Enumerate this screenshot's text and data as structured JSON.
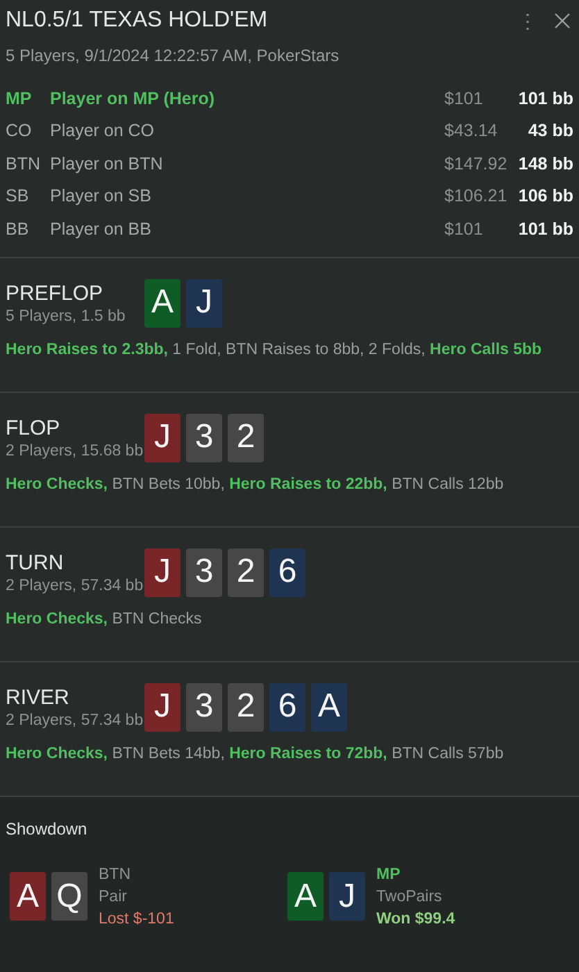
{
  "header": {
    "title": "NL0.5/1 TEXAS HOLD'EM",
    "subtitle": "5 Players, 9/1/2024 12:22:57 AM, PokerStars",
    "menu_glyph": "⋮"
  },
  "players": [
    {
      "position": "MP",
      "name": "Player on MP (Hero)",
      "stack": "$101",
      "bb": "101 bb",
      "hero": true
    },
    {
      "position": "CO",
      "name": "Player on CO",
      "stack": "$43.14",
      "bb": "43 bb",
      "hero": false
    },
    {
      "position": "BTN",
      "name": "Player on BTN",
      "stack": "$147.92",
      "bb": "148 bb",
      "hero": false
    },
    {
      "position": "SB",
      "name": "Player on SB",
      "stack": "$106.21",
      "bb": "106 bb",
      "hero": false
    },
    {
      "position": "BB",
      "name": "Player on BB",
      "stack": "$101",
      "bb": "101 bb",
      "hero": false
    }
  ],
  "streets": [
    {
      "name": "PREFLOP",
      "info": "5 Players, 1.5 bb",
      "cards": [
        {
          "rank": "A",
          "color": "#0f5c26"
        },
        {
          "rank": "J",
          "color": "#1e3450"
        }
      ],
      "actions": [
        {
          "text": "Hero Raises to 2.3bb,",
          "hero": true
        },
        {
          "text": "1 Fold, BTN Raises to 8bb, 2 Folds,",
          "hero": false
        },
        {
          "text": "Hero Calls 5bb",
          "hero": true
        }
      ]
    },
    {
      "name": "FLOP",
      "info": "2 Players, 15.68 bb",
      "cards": [
        {
          "rank": "J",
          "color": "#7a2628"
        },
        {
          "rank": "3",
          "color": "#474747"
        },
        {
          "rank": "2",
          "color": "#474747"
        }
      ],
      "actions": [
        {
          "text": "Hero Checks,",
          "hero": true
        },
        {
          "text": "BTN Bets 10bb,",
          "hero": false
        },
        {
          "text": "Hero Raises to 22bb,",
          "hero": true
        },
        {
          "text": "BTN Calls 12bb",
          "hero": false
        }
      ]
    },
    {
      "name": "TURN",
      "info": "2 Players, 57.34 bb",
      "cards": [
        {
          "rank": "J",
          "color": "#7a2628"
        },
        {
          "rank": "3",
          "color": "#474747"
        },
        {
          "rank": "2",
          "color": "#474747"
        },
        {
          "rank": "6",
          "color": "#1e3450"
        }
      ],
      "actions": [
        {
          "text": "Hero Checks,",
          "hero": true
        },
        {
          "text": "BTN Checks",
          "hero": false
        }
      ]
    },
    {
      "name": "RIVER",
      "info": "2 Players, 57.34 bb",
      "cards": [
        {
          "rank": "J",
          "color": "#7a2628"
        },
        {
          "rank": "3",
          "color": "#474747"
        },
        {
          "rank": "2",
          "color": "#474747"
        },
        {
          "rank": "6",
          "color": "#1e3450"
        },
        {
          "rank": "A",
          "color": "#1e3450"
        }
      ],
      "actions": [
        {
          "text": "Hero Checks,",
          "hero": true
        },
        {
          "text": "BTN Bets 14bb,",
          "hero": false
        },
        {
          "text": "Hero Raises to 72bb,",
          "hero": true
        },
        {
          "text": "BTN Calls 57bb",
          "hero": false
        }
      ]
    }
  ],
  "showdown": {
    "title": "Showdown",
    "hands": [
      {
        "position": "BTN",
        "hero": false,
        "cards": [
          {
            "rank": "A",
            "color": "#7a2628"
          },
          {
            "rank": "Q",
            "color": "#474747"
          }
        ],
        "hand": "Pair",
        "result": "Lost $-101",
        "kind": "lost"
      },
      {
        "position": "MP",
        "hero": true,
        "cards": [
          {
            "rank": "A",
            "color": "#0f5c26"
          },
          {
            "rank": "J",
            "color": "#1e3450"
          }
        ],
        "hand": "TwoPairs",
        "result": "Won $99.4",
        "kind": "won"
      }
    ]
  }
}
